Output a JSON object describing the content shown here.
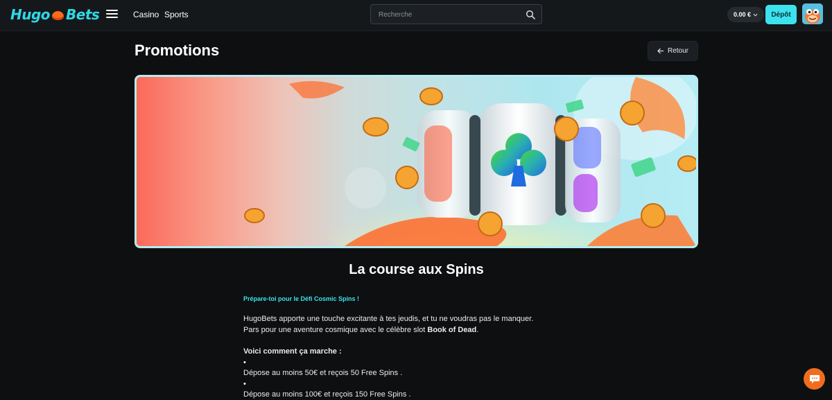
{
  "brand": {
    "logo_text_left": "Hugo",
    "logo_text_right": "Bets"
  },
  "header": {
    "menu_icon": "hamburger-menu-icon",
    "nav": [
      {
        "label": "Casino"
      },
      {
        "label": "Sports"
      }
    ],
    "search": {
      "placeholder": "Recherche",
      "icon": "search-icon"
    },
    "balance": {
      "amount": "0.00 €",
      "icon": "chevron-down-icon"
    },
    "deposit_label": "Dépôt",
    "avatar_icon": "user-avatar"
  },
  "page": {
    "title": "Promotions",
    "back_label": "Retour",
    "back_icon": "arrow-left-icon"
  },
  "promotion": {
    "title": "La course aux Spins",
    "highlight": "Prépare-toi pour le Défi Cosmic Spins !",
    "para_line1": "HugoBets apporte une touche excitante à tes jeudis, et tu ne voudras pas le manquer.",
    "para_line2_pre": "Pars pour une aventure cosmique avec le célèbre slot ",
    "para_line2_bold": "Book of Dead",
    "para_line2_post": ".",
    "steps_heading": "Voici comment ça marche :",
    "steps": [
      "Dépose au moins 50€ et reçois 50 Free Spins .",
      "Dépose au moins 100€ et reçois 150 Free Spins ."
    ]
  },
  "chat": {
    "icon": "chat-bubble-icon"
  },
  "colors": {
    "accent": "#3ce3ee",
    "background": "#0d0f11",
    "header": "#15181b",
    "chat": "#f06d1f"
  }
}
